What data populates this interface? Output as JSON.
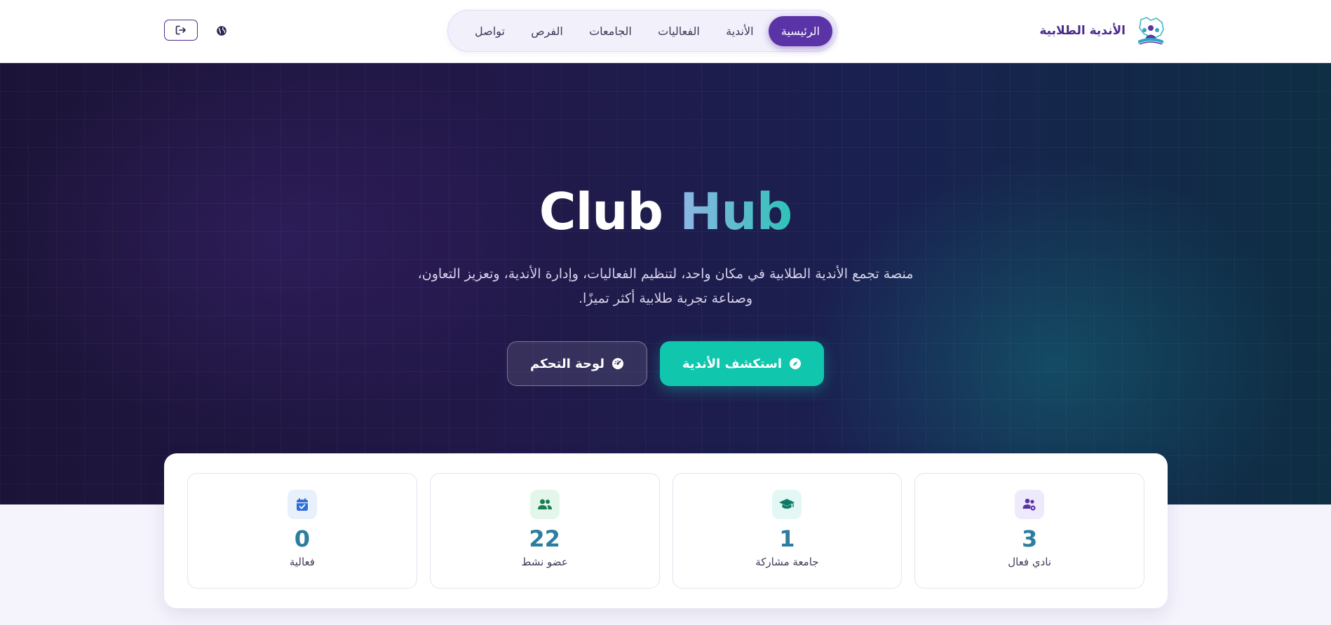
{
  "brand": {
    "name": "الأندية الطلابية",
    "logo_icon": "students-map-logo-icon"
  },
  "nav": {
    "items": [
      {
        "label": "الرئيسية",
        "active": true
      },
      {
        "label": "الأندية",
        "active": false
      },
      {
        "label": "الفعاليات",
        "active": false
      },
      {
        "label": "الجامعات",
        "active": false
      },
      {
        "label": "الفرص",
        "active": false
      },
      {
        "label": "تواصل",
        "active": false
      }
    ],
    "lang_icon": "globe-icon",
    "logout_icon": "logout-icon"
  },
  "hero": {
    "title_part1": "Club",
    "title_part2": "Hub",
    "description": "منصة تجمع الأندية الطلابية في مكان واحد، لتنظيم الفعاليات، وإدارة الأندية، وتعزيز التعاون، وصناعة تجربة طلابية أكثر تميزًا.",
    "explore_button": "استكشف الأندية",
    "dashboard_button": "لوحة التحكم"
  },
  "stats": [
    {
      "value": "3",
      "label": "نادي فعال",
      "icon": "users-cog-icon",
      "color": "#5a34a7",
      "bg": "#efeafb"
    },
    {
      "value": "1",
      "label": "جامعة مشاركة",
      "icon": "graduation-cap-icon",
      "color": "#0e9f8a",
      "bg": "#e3f8f4"
    },
    {
      "value": "22",
      "label": "عضو نشط",
      "icon": "user-group-icon",
      "color": "#1fa866",
      "bg": "#e2f7ea"
    },
    {
      "value": "0",
      "label": "فعالية",
      "icon": "calendar-check-icon",
      "color": "#2f6fd6",
      "bg": "#e8f0fc"
    }
  ],
  "colors": {
    "brand_purple": "#5a34a7",
    "teal": "#10c7ae",
    "stat_number": "#2c7da0"
  }
}
